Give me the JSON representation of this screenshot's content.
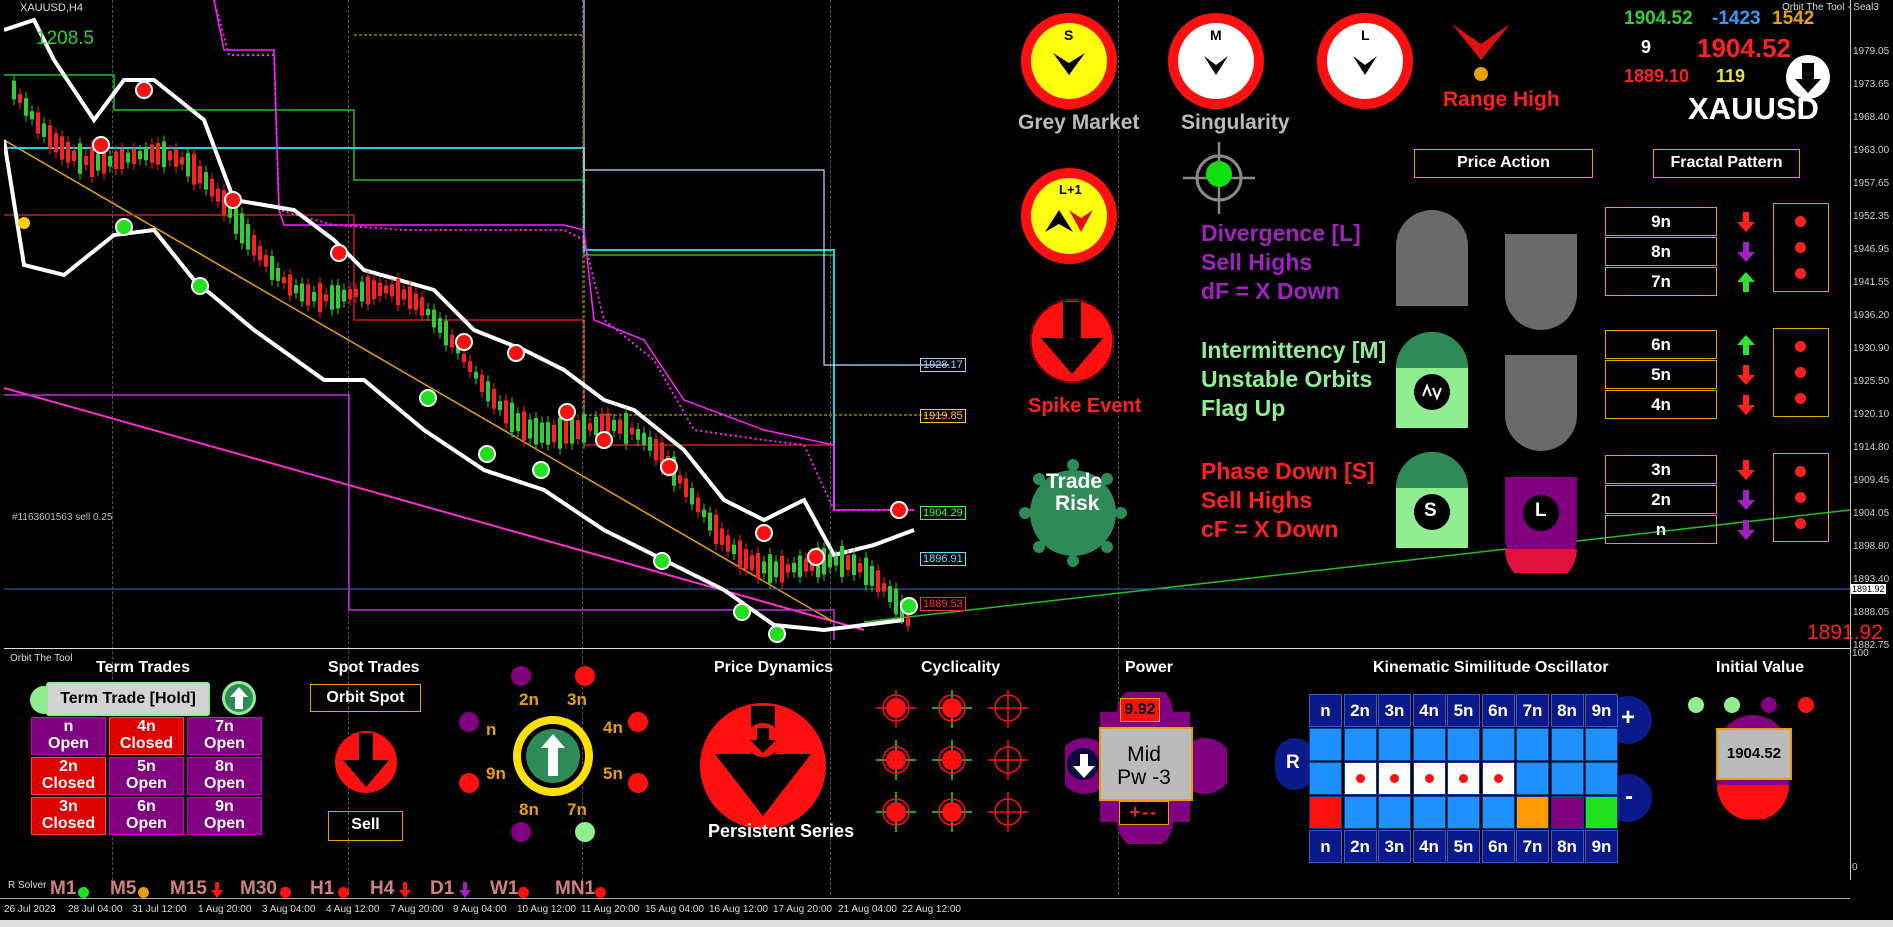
{
  "symbol_label": "XAUUSD,H4",
  "top_left_value": "1208.5",
  "order_comment": "#1163601563 sell 0.25",
  "right_axis_ticks": [
    "1979.05",
    "1973.65",
    "1968.40",
    "1963.00",
    "1957.65",
    "1952.35",
    "1946.95",
    "1941.55",
    "1936.20",
    "1930.90",
    "1925.50",
    "1920.10",
    "1914.80",
    "1909.45",
    "1904.05",
    "1898.80",
    "1893.40",
    "1888.05",
    "1882.75"
  ],
  "right_axis_current": "1891.92",
  "lower_axis_ticks": [
    "100",
    "0"
  ],
  "price_tags": [
    {
      "text": "1928.17",
      "color": "#a0d0ff"
    },
    {
      "text": "1919.85",
      "color": "#ffc040"
    },
    {
      "text": "1904.29",
      "color": "#40ff40"
    },
    {
      "text": "1896.91",
      "color": "#60e0ff"
    },
    {
      "text": "1889.53",
      "color": "#ff3030"
    }
  ],
  "bottom_right_price": "1891.92",
  "header_right": {
    "title": "Orbit The Tool - Seal3",
    "v1": "1904.52",
    "v2": "-1423",
    "v3": "1542",
    "v4": "9",
    "v5": "1904.52",
    "v6": "1889.10",
    "v7": "119",
    "symbol": "XAUUSD"
  },
  "dials": {
    "s_letter": "S",
    "m_letter": "M",
    "l_letter": "L",
    "l1_letter": "L+1",
    "grey_market": "Grey Market",
    "singularity": "Singularity",
    "range_high": "Range High",
    "spike_event": "Spike Event",
    "trade_risk_line1": "Trade",
    "trade_risk_line2": "Risk"
  },
  "buttons": {
    "price_action": "Price Action",
    "fractal_pattern": "Fractal Pattern"
  },
  "signals": {
    "div_1": "Divergence [L]",
    "div_2": "Sell Highs",
    "div_3": "dF = X Down",
    "int_1": "Intermittency [M]",
    "int_2": "Unstable Orbits",
    "int_3": "Flag Up",
    "phase_1": "Phase Down [S]",
    "phase_2": "Sell Highs",
    "phase_3": "cF = X Down"
  },
  "fractal_levels": [
    "9n",
    "8n",
    "7n",
    "6n",
    "5n",
    "4n",
    "3n",
    "2n",
    "n"
  ],
  "fractal_arrows": [
    "down-red",
    "down-purple",
    "up-green",
    "up-green",
    "down-red",
    "down-red",
    "down-red",
    "down-purple",
    "down-purple"
  ],
  "shield_letters": {
    "s": "S",
    "l": "L"
  },
  "lower": {
    "window_label": "Orbit The Tool",
    "term_trades": "Term Trades",
    "term_button": "Term Trade [Hold]",
    "term_cells": [
      {
        "l1": "n",
        "l2": "Open",
        "state": "open"
      },
      {
        "l1": "4n",
        "l2": "Closed",
        "state": "closed"
      },
      {
        "l1": "7n",
        "l2": "Open",
        "state": "open"
      },
      {
        "l1": "2n",
        "l2": "Closed",
        "state": "closed"
      },
      {
        "l1": "5n",
        "l2": "Open",
        "state": "open"
      },
      {
        "l1": "8n",
        "l2": "Open",
        "state": "open"
      },
      {
        "l1": "3n",
        "l2": "Closed",
        "state": "closed"
      },
      {
        "l1": "6n",
        "l2": "Open",
        "state": "open"
      },
      {
        "l1": "9n",
        "l2": "Open",
        "state": "open"
      }
    ],
    "spot_trades": "Spot Trades",
    "orbit_spot": "Orbit Spot",
    "sell": "Sell",
    "orbit_labels": {
      "n2": "2n",
      "n3": "3n",
      "n": "n",
      "n4": "4n",
      "n9": "9n",
      "n5": "5n",
      "n8": "8n",
      "n7": "7n"
    },
    "price_dynamics": "Price Dynamics",
    "persistent_series": "Persistent Series",
    "cyclicality": "Cyclicality",
    "power": "Power",
    "power_value": "9.92",
    "power_mid": "Mid",
    "power_pw": "Pw -3",
    "power_signs": "+--",
    "kso": "Kinematic Similitude Oscillator",
    "kso_headers": [
      "n",
      "2n",
      "3n",
      "4n",
      "5n",
      "6n",
      "7n",
      "8n",
      "9n"
    ],
    "kso_r": "R",
    "kso_plus": "+",
    "kso_minus": "-",
    "initial_value": "Initial Value",
    "initial_value_num": "1904.52"
  },
  "r_solver": "R Solver",
  "timeframes": [
    "M1",
    "M5",
    "M15",
    "M30",
    "H1",
    "H4",
    "D1",
    "W1",
    "MN1"
  ],
  "x_ticks": [
    "26 Jul 2023",
    "28 Jul 04:00",
    "31 Jul 12:00",
    "1 Aug 20:00",
    "3 Aug 04:00",
    "4 Aug 12:00",
    "7 Aug 20:00",
    "9 Aug 04:00",
    "10 Aug 12:00",
    "11 Aug 20:00",
    "15 Aug 04:00",
    "16 Aug 12:00",
    "17 Aug 20:00",
    "21 Aug 04:00",
    "22 Aug 12:00"
  ],
  "colors": {
    "bull": "#32cd32",
    "bear": "#ff2020",
    "accent_orange": "#e8a000",
    "purple": "#800080"
  }
}
